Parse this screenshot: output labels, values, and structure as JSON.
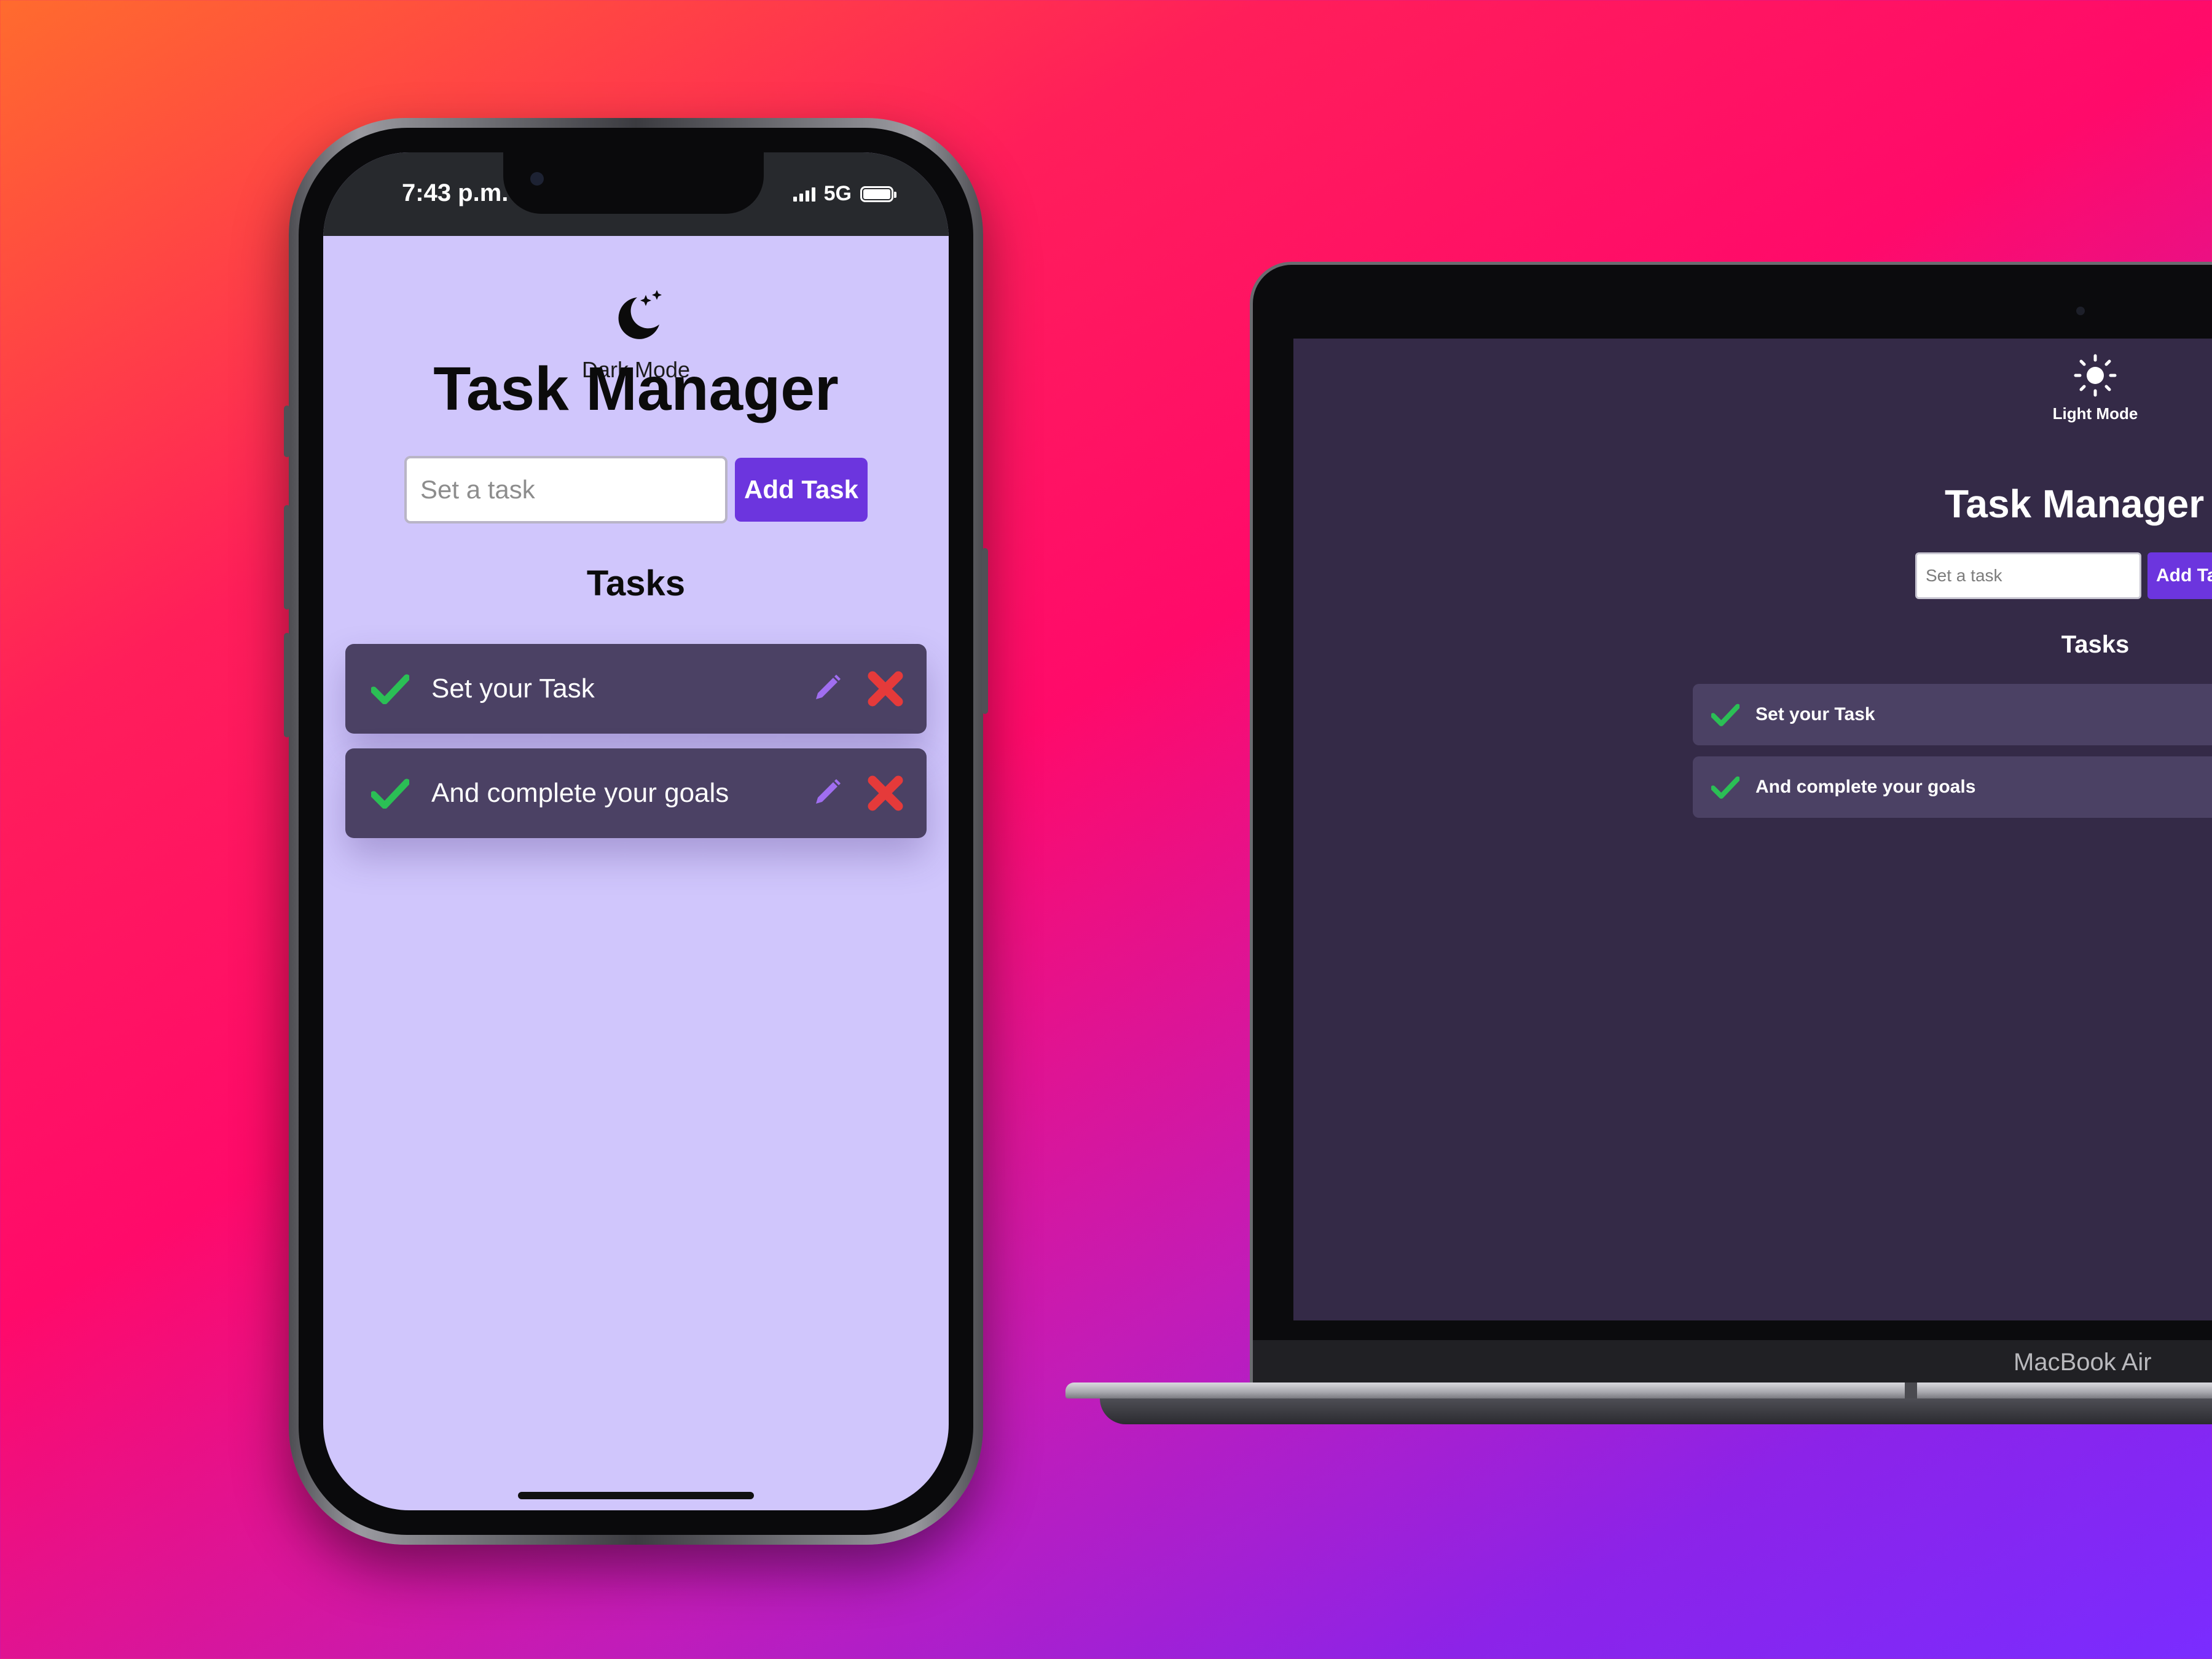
{
  "phone": {
    "status_bar": {
      "time": "7:43 p.m.",
      "network": "5G"
    },
    "mode_toggle": {
      "label": "Dark Mode",
      "icon": "moon-stars-icon"
    },
    "title": "Task Manager",
    "input": {
      "placeholder": "Set a task",
      "value": ""
    },
    "add_button": "Add Task",
    "tasks_heading": "Tasks",
    "tasks": [
      {
        "text": "Set your Task"
      },
      {
        "text": "And complete your goals"
      }
    ]
  },
  "laptop": {
    "brand": "MacBook Air",
    "mode_toggle": {
      "label": "Light Mode",
      "icon": "sun-icon"
    },
    "title": "Task Manager",
    "input": {
      "placeholder": "Set a task",
      "value": ""
    },
    "add_button": "Add Task",
    "tasks_heading": "Tasks",
    "tasks": [
      {
        "text": "Set your Task"
      },
      {
        "text": "And complete your goals"
      }
    ]
  },
  "colors": {
    "light_bg": "#d0c6fc",
    "dark_bg": "#342a47",
    "task_card": "#4b4164",
    "accent": "#6c35de",
    "check": "#2bbf55",
    "delete": "#e53a3a",
    "edit": "#a06ef0"
  }
}
